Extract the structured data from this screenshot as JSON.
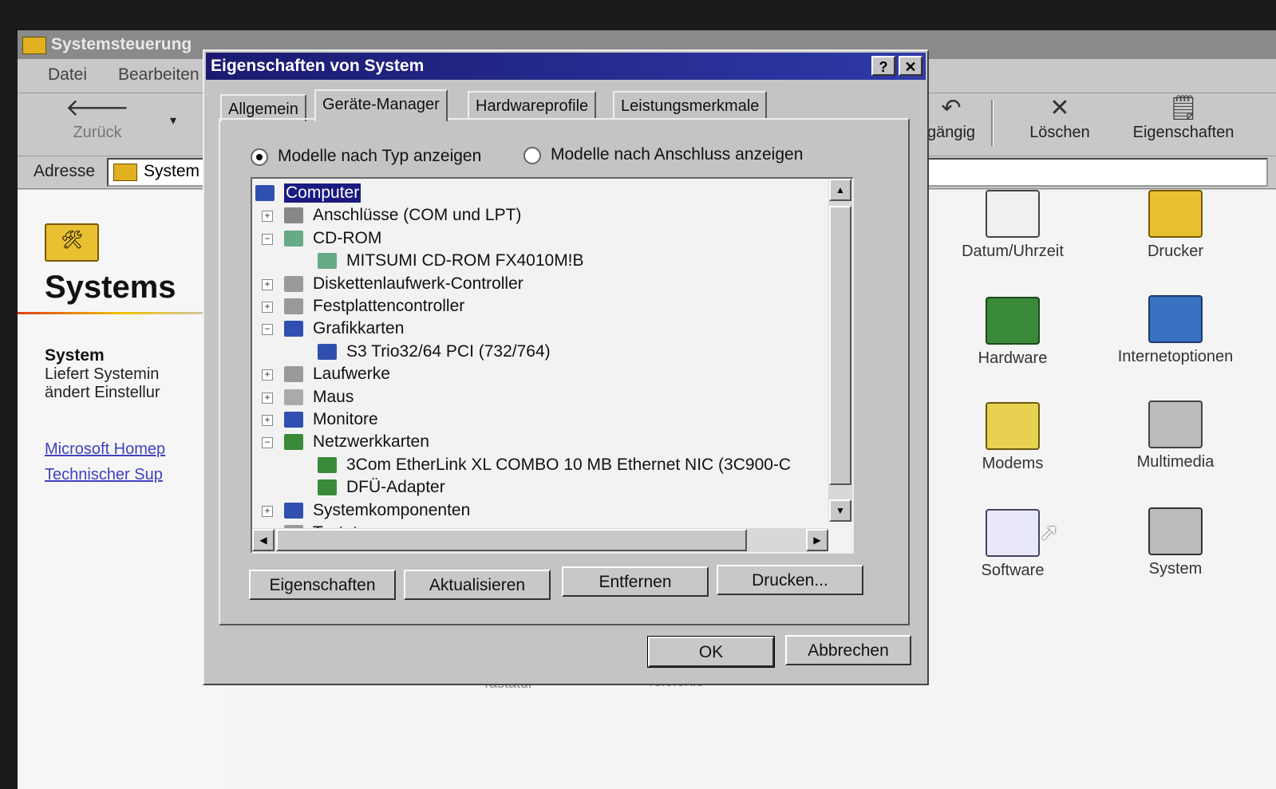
{
  "background_window": {
    "title": "Systemsteuerung",
    "menu": [
      "Datei",
      "Bearbeiten"
    ],
    "toolbar": {
      "back": "Zurück",
      "undo_partial": "gängig",
      "delete": "Löschen",
      "properties": "Eigenschaften"
    },
    "address": {
      "label": "Adresse",
      "value": "System"
    },
    "left_pane": {
      "title": "Systems",
      "item_name": "System",
      "desc_line1": "Liefert Systemin",
      "desc_line2": "ändert Einstellur",
      "link1": "Microsoft Homep",
      "link2": "Technischer Sup"
    },
    "icons": [
      {
        "label": "Datum/Uhrzeit"
      },
      {
        "label": "Drucker"
      },
      {
        "label": "Hardware"
      },
      {
        "label": "Internetoptionen"
      },
      {
        "label": "Modems"
      },
      {
        "label": "Multimedia"
      },
      {
        "label": "Software"
      },
      {
        "label": "System"
      }
    ],
    "faint_labels": [
      "Tastatur",
      "Telefonie"
    ]
  },
  "dialog": {
    "title": "Eigenschaften von System",
    "help_button": "?",
    "close_button": "✕",
    "tabs": [
      "Allgemein",
      "Geräte-Manager",
      "Hardwareprofile",
      "Leistungsmerkmale"
    ],
    "active_tab": "Geräte-Manager",
    "radio_by_type": "Modelle nach Typ anzeigen",
    "radio_by_connection": "Modelle nach Anschluss anzeigen",
    "tree": [
      {
        "label": "Computer",
        "level": 0,
        "expander": "",
        "selected": true
      },
      {
        "label": "Anschlüsse (COM und LPT)",
        "level": 1,
        "expander": "+"
      },
      {
        "label": "CD-ROM",
        "level": 1,
        "expander": "−"
      },
      {
        "label": "MITSUMI CD-ROM FX4010M!B",
        "level": 2,
        "expander": ""
      },
      {
        "label": "Diskettenlaufwerk-Controller",
        "level": 1,
        "expander": "+"
      },
      {
        "label": "Festplattencontroller",
        "level": 1,
        "expander": "+"
      },
      {
        "label": "Grafikkarten",
        "level": 1,
        "expander": "−"
      },
      {
        "label": "S3 Trio32/64 PCI (732/764)",
        "level": 2,
        "expander": ""
      },
      {
        "label": "Laufwerke",
        "level": 1,
        "expander": "+"
      },
      {
        "label": "Maus",
        "level": 1,
        "expander": "+"
      },
      {
        "label": "Monitore",
        "level": 1,
        "expander": "+"
      },
      {
        "label": "Netzwerkkarten",
        "level": 1,
        "expander": "−"
      },
      {
        "label": "3Com EtherLink XL COMBO 10 MB Ethernet NIC (3C900-C",
        "level": 2,
        "expander": ""
      },
      {
        "label": "DFÜ-Adapter",
        "level": 2,
        "expander": ""
      },
      {
        "label": "Systemkomponenten",
        "level": 1,
        "expander": "+"
      },
      {
        "label": "Tastatur",
        "level": 1,
        "expander": "+"
      }
    ],
    "buttons": {
      "properties": "Eigenschaften",
      "refresh": "Aktualisieren",
      "remove": "Entfernen",
      "print": "Drucken...",
      "ok": "OK",
      "cancel": "Abbrechen"
    }
  }
}
